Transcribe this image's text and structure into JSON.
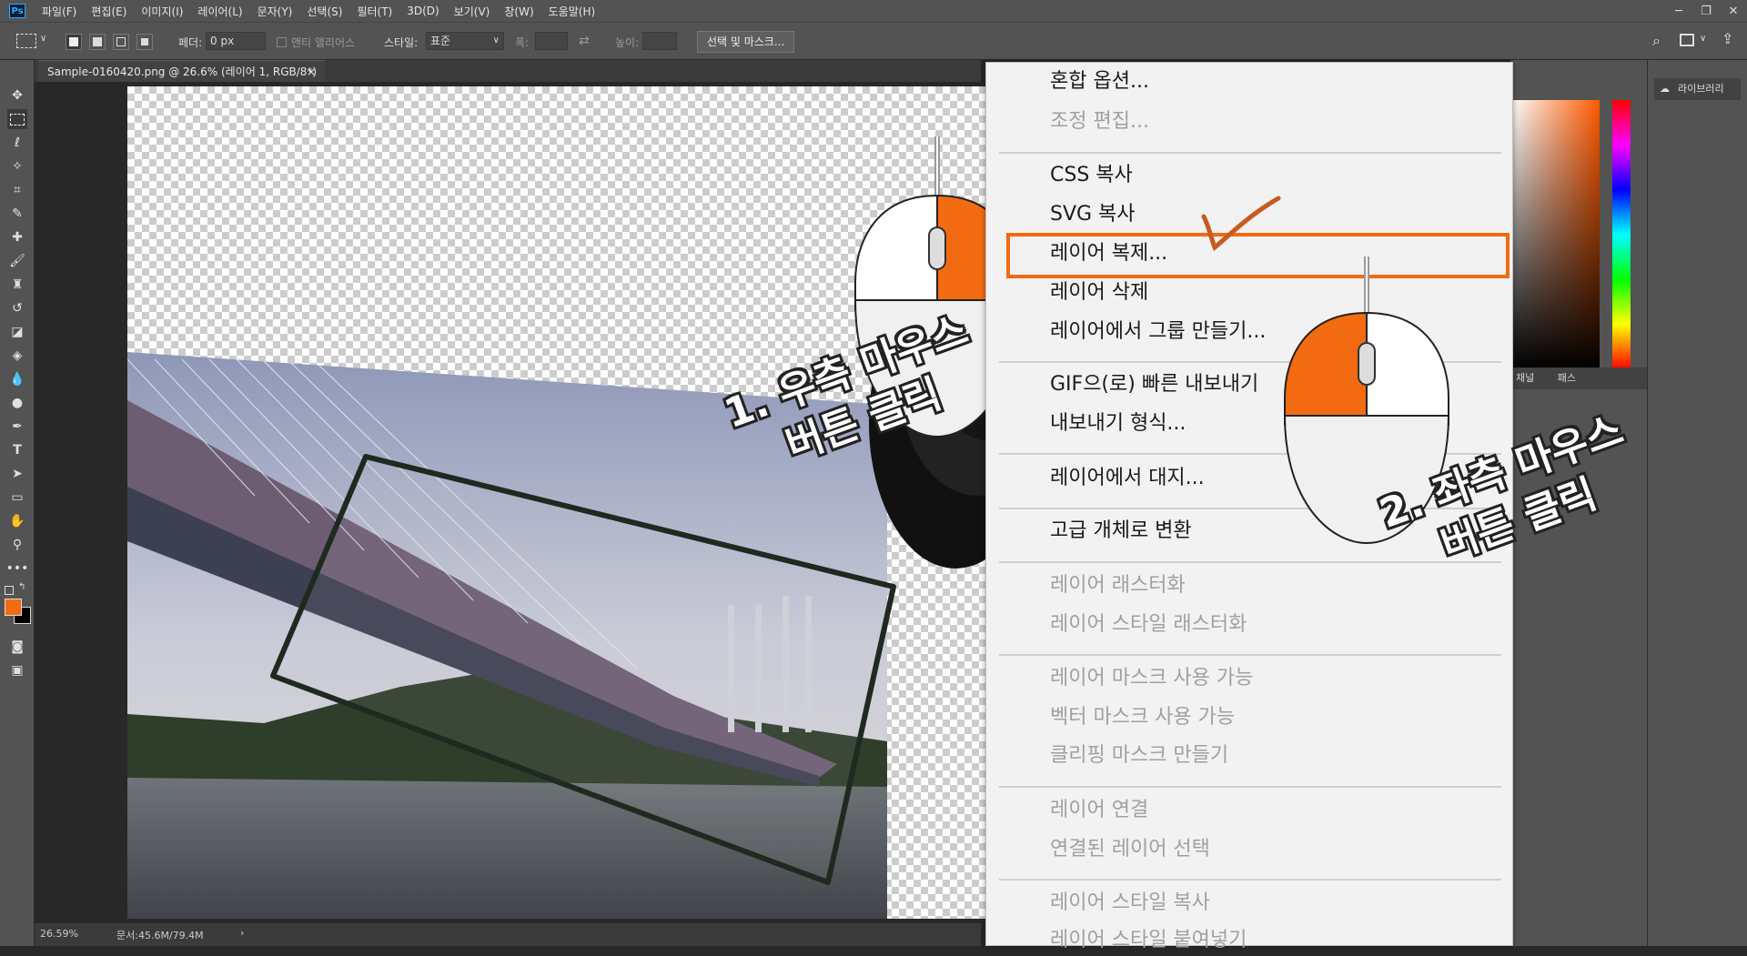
{
  "menubar": {
    "app_icon": "Ps",
    "items": [
      "파일(F)",
      "편집(E)",
      "이미지(I)",
      "레이어(L)",
      "문자(Y)",
      "선택(S)",
      "필터(T)",
      "3D(D)",
      "보기(V)",
      "창(W)",
      "도움말(H)"
    ]
  },
  "options": {
    "feather_label": "페더:",
    "feather_value": "0 px",
    "antialias_label": "앤티 앨리어스",
    "style_label": "스타일:",
    "style_value": "표준",
    "width_label": "폭:",
    "height_label": "높이:",
    "select_mask_button": "선택 및 마스크..."
  },
  "document": {
    "tab_title": "Sample-0160420.png @ 26.6% (레이어 1, RGB/8*) *",
    "zoom": "26.59%",
    "doc_info": "문서:45.6M/79.4M"
  },
  "panels": {
    "libraries_label": "라이브러리",
    "channels_label": "채널",
    "paths_label": "패스"
  },
  "context_menu": {
    "items": [
      {
        "label": "혼합 옵션...",
        "enabled": true
      },
      {
        "label": "조정 편집...",
        "enabled": false
      },
      {
        "label": "CSS 복사",
        "enabled": true
      },
      {
        "label": "SVG 복사",
        "enabled": true
      },
      {
        "label": "레이어 복제...",
        "enabled": true,
        "highlighted": true
      },
      {
        "label": "레이어 삭제",
        "enabled": true
      },
      {
        "label": "레이어에서 그룹 만들기...",
        "enabled": true
      },
      {
        "label": "GIF으(로) 빠른 내보내기",
        "enabled": true
      },
      {
        "label": "내보내기 형식...",
        "enabled": true
      },
      {
        "label": "레이어에서 대지...",
        "enabled": true
      },
      {
        "label": "고급 개체로 변환",
        "enabled": true
      },
      {
        "label": "레이어 래스터화",
        "enabled": false
      },
      {
        "label": "레이어 스타일 래스터화",
        "enabled": false
      },
      {
        "label": "레이어 마스크 사용 가능",
        "enabled": false
      },
      {
        "label": "벡터 마스크 사용 가능",
        "enabled": false
      },
      {
        "label": "클리핑 마스크 만들기",
        "enabled": false
      },
      {
        "label": "레이어 연결",
        "enabled": false
      },
      {
        "label": "연결된 레이어 선택",
        "enabled": false
      },
      {
        "label": "레이어 스타일 복사",
        "enabled": false
      },
      {
        "label": "레이어 스타일 붙여넣기",
        "enabled": false
      }
    ]
  },
  "annotations": {
    "step1_line1": "1. 우측 마우스",
    "step1_line2": "버튼 클릭",
    "step2_line1": "2. 좌측 마우스",
    "step2_line2": "버튼 클릭"
  },
  "colors": {
    "accent": "#f26b10",
    "foreground_swatch": "#f26b10",
    "background_swatch": "#000000"
  }
}
